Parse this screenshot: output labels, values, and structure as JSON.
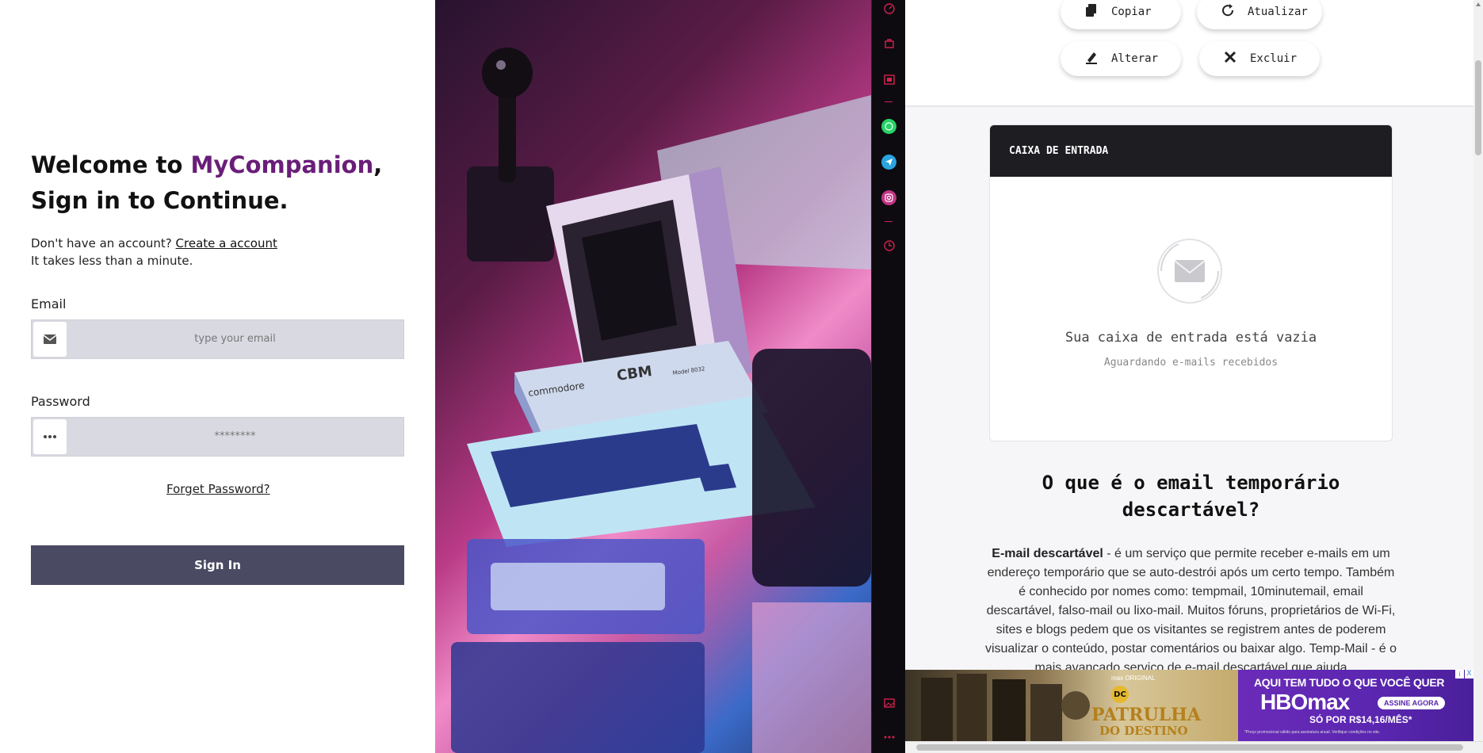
{
  "login": {
    "welcome_prefix": "Welcome to ",
    "brand": "MyCompanion",
    "welcome_suffix": ",",
    "line2": "Sign in to Continue.",
    "signup_text": "Don't have an account? ",
    "signup_link": "Create a account",
    "signup_note": "It takes less than a minute.",
    "email_label": "Email",
    "email_placeholder": "type your email",
    "password_label": "Password",
    "password_placeholder": "********",
    "forgot_link": "Forget Password?",
    "signin_button": "Sign In",
    "email_icon": "envelope-icon",
    "password_icon": "dots-icon"
  },
  "photo": {
    "brand_text": "commodore",
    "model_text": "CBM",
    "model_number": "Model 8032"
  },
  "strip": {
    "icons": [
      "speedometer-icon",
      "bag-icon",
      "calendar-icon",
      "whatsapp-icon",
      "telegram-icon",
      "instagram-icon",
      "clock-icon",
      "image-icon",
      "more-icon"
    ],
    "colors": {
      "whatsapp": "#25d366",
      "telegram": "#2aa3df",
      "instagram": "#c13584",
      "accent": "#d4214c"
    }
  },
  "mail": {
    "actions": {
      "copy": "Copiar",
      "refresh": "Atualizar",
      "change": "Alterar",
      "delete": "Excluir"
    },
    "inbox_title": "CAIXA DE ENTRADA",
    "empty_title": "Sua caixa de entrada está vazia",
    "empty_subtitle": "Aguardando e-mails recebidos",
    "heading": "O que é o email temporário descartável?",
    "para_bold": "E-mail descartável",
    "para_text": " - é um serviço que permite receber e-mails em um endereço temporário que se auto-destrói após um certo tempo. Também é conhecido por nomes como: tempmail, 10minutemail, email descartável, falso-mail ou lixo-mail. Muitos fóruns, proprietários de Wi-Fi, sites e blogs pedem que os visitantes se registrem antes de poderem visualizar o conteúdo, postar comentários ou baixar algo. Temp-Mail - é o mais avançado serviço de e-mail descartável que ajuda"
  },
  "ad": {
    "max_original": "max ORIGINAL",
    "dc": "DC",
    "title_line1": "PATRULHA",
    "title_line2": "DO DESTINO",
    "headline": "AQUI TEM TUDO O QUE VOCÊ QUER",
    "brand": "HBOmax",
    "cta": "ASSINE AGORA",
    "price": "SÓ POR R$14,16/MÊS*",
    "fineprint": "*Preço promocional válido para assinatura anual. Verifique condições no site.",
    "close_label": "X",
    "info_label": "i"
  }
}
